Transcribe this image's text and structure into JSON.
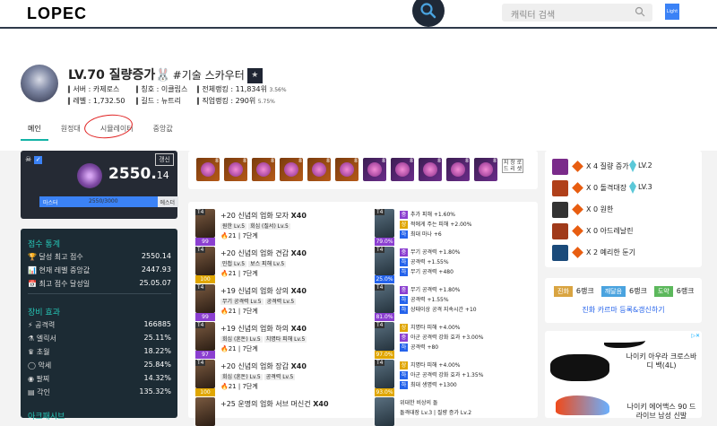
{
  "topbar": {
    "logo": "LOPEC",
    "search_placeholder": "캐릭터 검색",
    "theme_toggle": "Light"
  },
  "profile": {
    "title": "LV.70 질량증가",
    "title_emoji": "🐰",
    "title_tag": "#기술 스카우터",
    "badge_icon": "star-badge-icon",
    "server_label": "서버 : 카제로스",
    "level_label": "레벨 : 1,732.50",
    "title_name_label": "칭호 : 이클립스",
    "guild_label": "길드 : 뉴트리",
    "total_rank_label": "전체랭킹 : 11,834위",
    "total_rank_pct": "3.56%",
    "class_rank_label": "직업랭킹 : 290위",
    "class_rank_pct": "5.75%"
  },
  "tabs": [
    {
      "label": "메인",
      "active": true
    },
    {
      "label": "원정대",
      "active": false
    },
    {
      "label": "시뮬레이터",
      "active": false
    },
    {
      "label": "중앙값",
      "active": false
    }
  ],
  "score_card": {
    "renew_label": "갱신",
    "score_int": "2550.",
    "score_dec": "14",
    "bar_left": "마스터",
    "bar_mid": "2550/3000",
    "bar_right": "에스더",
    "progress": 0.85
  },
  "stats": {
    "score_section": "점수 통계",
    "score_rows": [
      {
        "label": "달성 최고 점수",
        "value": "2550.14",
        "icon": "trophy-icon"
      },
      {
        "label": "현재 레벨 중앙값",
        "value": "2447.93",
        "icon": "chart-icon"
      },
      {
        "label": "최고 점수 달성일",
        "value": "25.05.07",
        "icon": "calendar-icon"
      }
    ],
    "equip_section": "장비 효과",
    "equip_rows": [
      {
        "label": "공격력",
        "value": "166885",
        "icon": "lightning-icon"
      },
      {
        "label": "엘릭서",
        "value": "25.11%",
        "icon": "flask-icon"
      },
      {
        "label": "초월",
        "value": "18.22%",
        "icon": "crown-icon"
      },
      {
        "label": "악세",
        "value": "25.84%",
        "icon": "ring-icon"
      },
      {
        "label": "팔찌",
        "value": "14.32%",
        "icon": "bracelet-icon"
      },
      {
        "label": "각인",
        "value": "135.32%",
        "icon": "book-icon"
      }
    ],
    "next_section": "아크패시브"
  },
  "gems": {
    "levels": [
      "8",
      "8",
      "8",
      "8",
      "8",
      "8",
      "8",
      "8",
      "8",
      "8",
      "8"
    ],
    "side_label": "지 창 로 드 리 셋"
  },
  "equipment": [
    {
      "tier": "T4",
      "pct": "99",
      "name": "+20 신념의 업화 모자",
      "grade": "X40",
      "opts": [
        "원한 Lv.5",
        "회심 (질서) Lv.5"
      ],
      "elixir": "21",
      "elixir_tail": "7단계"
    },
    {
      "tier": "T4",
      "pct": "100",
      "name": "+20 신념의 업화 견갑",
      "grade": "X40",
      "opts": [
        "민첩 Lv.5",
        "보스 피해 Lv.5"
      ],
      "elixir": "21",
      "elixir_tail": "7단계"
    },
    {
      "tier": "T4",
      "pct": "99",
      "name": "+19 신념의 업화 상의",
      "grade": "X40",
      "opts": [
        "무기 공격력 Lv.5",
        "공격력 Lv.5"
      ],
      "elixir": "21",
      "elixir_tail": "7단계"
    },
    {
      "tier": "T4",
      "pct": "97",
      "name": "+19 신념의 업화 하의",
      "grade": "X40",
      "opts": [
        "회심 (혼돈) Lv.5",
        "치명타 피해 Lv.5"
      ],
      "elixir": "21",
      "elixir_tail": "7단계"
    },
    {
      "tier": "T4",
      "pct": "100",
      "name": "+20 신념의 업화 장갑",
      "grade": "X40",
      "opts": [
        "회심 (혼돈) Lv.5",
        "공격력 Lv.5"
      ],
      "elixir": "21",
      "elixir_tail": "7단계"
    },
    {
      "tier": "",
      "pct": "",
      "name": "+25 운명의 업화 서브 머신건",
      "grade": "X40",
      "opts": [],
      "elixir": "",
      "elixir_tail": ""
    }
  ],
  "accessories": [
    {
      "tier": "T4",
      "pct": "79.0%",
      "lines": [
        {
          "q": "중",
          "t": "추가 피해 +1.60%"
        },
        {
          "q": "상",
          "t": "적에게 주는 피해 +2.00%"
        },
        {
          "q": "하",
          "t": "최대 마나 +6"
        }
      ]
    },
    {
      "tier": "T4",
      "pct": "25.0%",
      "lines": [
        {
          "q": "중",
          "t": "무기 공격력 +1.80%"
        },
        {
          "q": "하",
          "t": "공격력 +1.55%"
        },
        {
          "q": "하",
          "t": "무기 공격력 +480"
        }
      ]
    },
    {
      "tier": "T4",
      "pct": "81.0%",
      "lines": [
        {
          "q": "중",
          "t": "무기 공격력 +1.80%"
        },
        {
          "q": "하",
          "t": "공격력 +1.55%"
        },
        {
          "q": "하",
          "t": "상태이상 공격 지속시간 +10"
        }
      ]
    },
    {
      "tier": "T4",
      "pct": "97.0%",
      "lines": [
        {
          "q": "상",
          "t": "치명타 피해 +4.00%"
        },
        {
          "q": "중",
          "t": "아군 공격력 강화 효과 +3.00%"
        },
        {
          "q": "하",
          "t": "공격력 +80"
        }
      ]
    },
    {
      "tier": "T4",
      "pct": "93.0%",
      "lines": [
        {
          "q": "상",
          "t": "치명타 피해 +4.00%"
        },
        {
          "q": "하",
          "t": "아군 공격력 강화 효과 +1.35%"
        },
        {
          "q": "하",
          "t": "최대 생명력 +1300"
        }
      ]
    },
    {
      "tier": "",
      "pct": "",
      "lines": [
        {
          "q": "",
          "t": "위대한 비상의 돌"
        },
        {
          "q": "",
          "t": "돌격대장 Lv.3 | 질량 증가 Lv.2"
        }
      ]
    }
  ],
  "engravings": [
    {
      "text": "X 4 질량 증가",
      "lv": "LV.2",
      "has_lv": true
    },
    {
      "text": "X 0 돌격대장",
      "lv": "LV.3",
      "has_lv": true
    },
    {
      "text": "X 0 원한",
      "lv": "",
      "has_lv": false
    },
    {
      "text": "X 0 아드레날린",
      "lv": "",
      "has_lv": false
    },
    {
      "text": "X 2 예리한 둔기",
      "lv": "",
      "has_lv": false
    }
  ],
  "cards": {
    "tags": [
      {
        "label": "진화",
        "rank": "6랭크",
        "color": "#d9a441"
      },
      {
        "label": "깨달음",
        "rank": "6랭크",
        "color": "#4aa3df"
      },
      {
        "label": "도약",
        "rank": "6랭크",
        "color": "#5cb85c"
      }
    ],
    "link": "진화 카르마 등록&갱신하기"
  },
  "ad": {
    "product1": "나이키 아우라 크로스바디 백(4L)",
    "product2": "나이키 에어맥스 90 드라이브 남성 신발"
  }
}
